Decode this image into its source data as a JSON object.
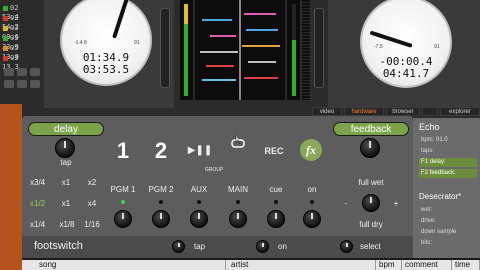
{
  "tracklist": [
    {
      "label": "02 53.4",
      "color": "#2fae2a"
    },
    {
      "label": "02 54.2",
      "color": "#d63a2a"
    },
    {
      "label": "03 09.6",
      "color": "#d6b72a"
    },
    {
      "label": "03 23.9",
      "color": "#2fae2a"
    },
    {
      "label": "05 13.0",
      "color": "#e08a2a"
    },
    {
      "label": "03 13.3",
      "color": "#d63a2a"
    }
  ],
  "deck_left": {
    "elapsed": "01:34.9",
    "remaining": "03:53.5",
    "left_small": "-1.4 8",
    "right_small": "91"
  },
  "deck_right": {
    "elapsed": "-00:00.4",
    "remaining": "04:41.7",
    "left_small": "-7.5",
    "right_small": "91"
  },
  "view_tabs": [
    {
      "label": "video",
      "active": false
    },
    {
      "label": "hardware",
      "active": true
    },
    {
      "label": "browser",
      "active": false
    },
    {
      "label": "",
      "active": false
    },
    {
      "label": "explorer",
      "active": false
    }
  ],
  "fx_panel": {
    "delay_label": "delay",
    "tap_label": "tap",
    "feedback_label": "feedback",
    "group_label": "GROUP",
    "deck1": "1",
    "deck2": "2",
    "play_pause": "▶❚❚",
    "rec_label": "REC",
    "fx_label": "fx",
    "beat_row1": [
      "x3/4",
      "x1",
      "x2"
    ],
    "beat_row2": [
      "x1/2",
      "x1",
      "x4"
    ],
    "beat_row3": [
      "x1/4",
      "x1/8",
      "1/16"
    ],
    "pgm_buttons": [
      "PGM 1",
      "PGM 2",
      "AUX",
      "MAIN",
      "cue",
      "on"
    ],
    "full_wet": "full wet",
    "full_dry": "full dry",
    "minus": "-",
    "plus": "+"
  },
  "footswitch": {
    "title": "footswitch",
    "tap": "tap",
    "on": "on",
    "select": "select"
  },
  "right_panel": {
    "echo_title": "Echo",
    "echo_rows": [
      {
        "label": "bpm: 91.0",
        "active": false
      },
      {
        "label": "taps:",
        "active": false
      },
      {
        "label": "F1 delay:",
        "active": true
      },
      {
        "label": "F2 feedback:",
        "active": true
      }
    ],
    "desecrator_title": "Desecrator*",
    "desecrator_rows": [
      {
        "label": "wet:",
        "active": false
      },
      {
        "label": "drive:",
        "active": false
      },
      {
        "label": "down sample",
        "active": false
      },
      {
        "label": "bits:",
        "active": false
      }
    ]
  },
  "table_header": [
    "song",
    "artist",
    "bpm",
    "comment",
    "time"
  ]
}
